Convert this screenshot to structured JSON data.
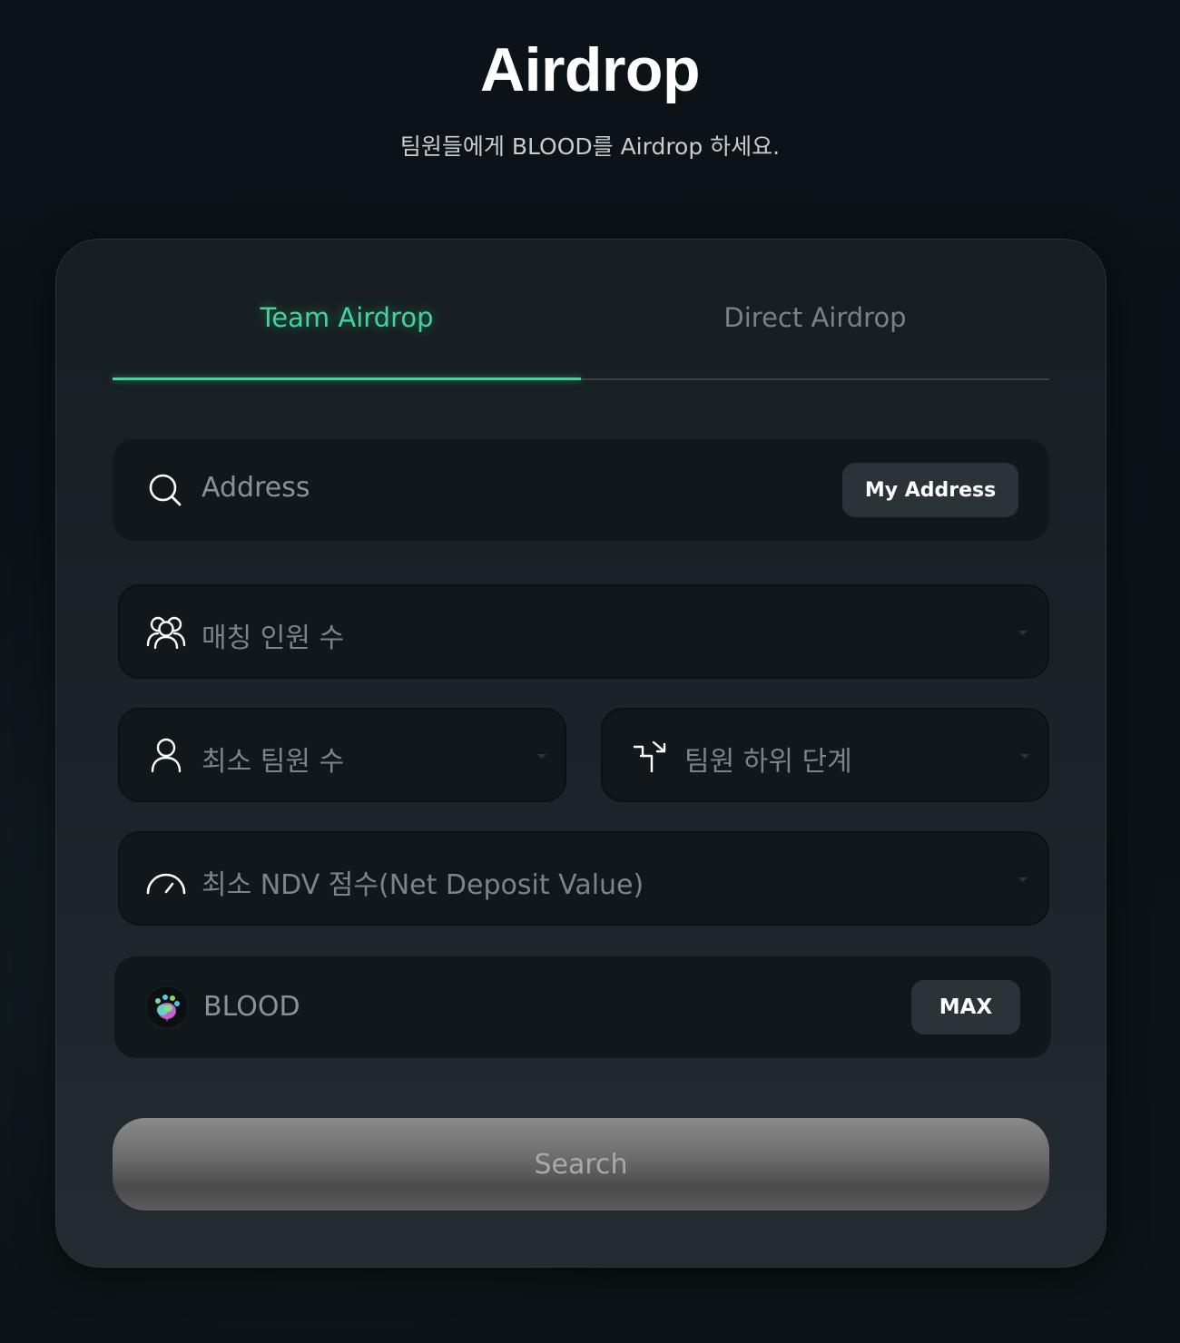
{
  "page": {
    "title": "Airdrop",
    "subtitle": "팀원들에게 BLOOD를 Airdrop 하세요."
  },
  "tabs": [
    {
      "label": "Team Airdrop",
      "active": true
    },
    {
      "label": "Direct Airdrop",
      "active": false
    }
  ],
  "address_field": {
    "placeholder": "Address",
    "icon": "search-icon",
    "button_label": "My Address"
  },
  "matching_members": {
    "placeholder": "매칭 인원 수",
    "icon": "users-group-icon"
  },
  "min_team_members": {
    "placeholder": "최소 팀원 수",
    "icon": "user-icon"
  },
  "team_sub_level": {
    "placeholder": "팀원 하위 단계",
    "icon": "stairs-arrow-icon"
  },
  "min_ndv": {
    "placeholder": "최소 NDV 점수(Net Deposit Value)",
    "icon": "gauge-icon"
  },
  "amount_field": {
    "token": "BLOOD",
    "icon": "blood-token-logo",
    "button_label": "MAX"
  },
  "search_button": {
    "label": "Search"
  },
  "colors": {
    "accent": "#45d39c",
    "background": "#0b1216",
    "card": "#1b2428",
    "field": "#10181c"
  }
}
